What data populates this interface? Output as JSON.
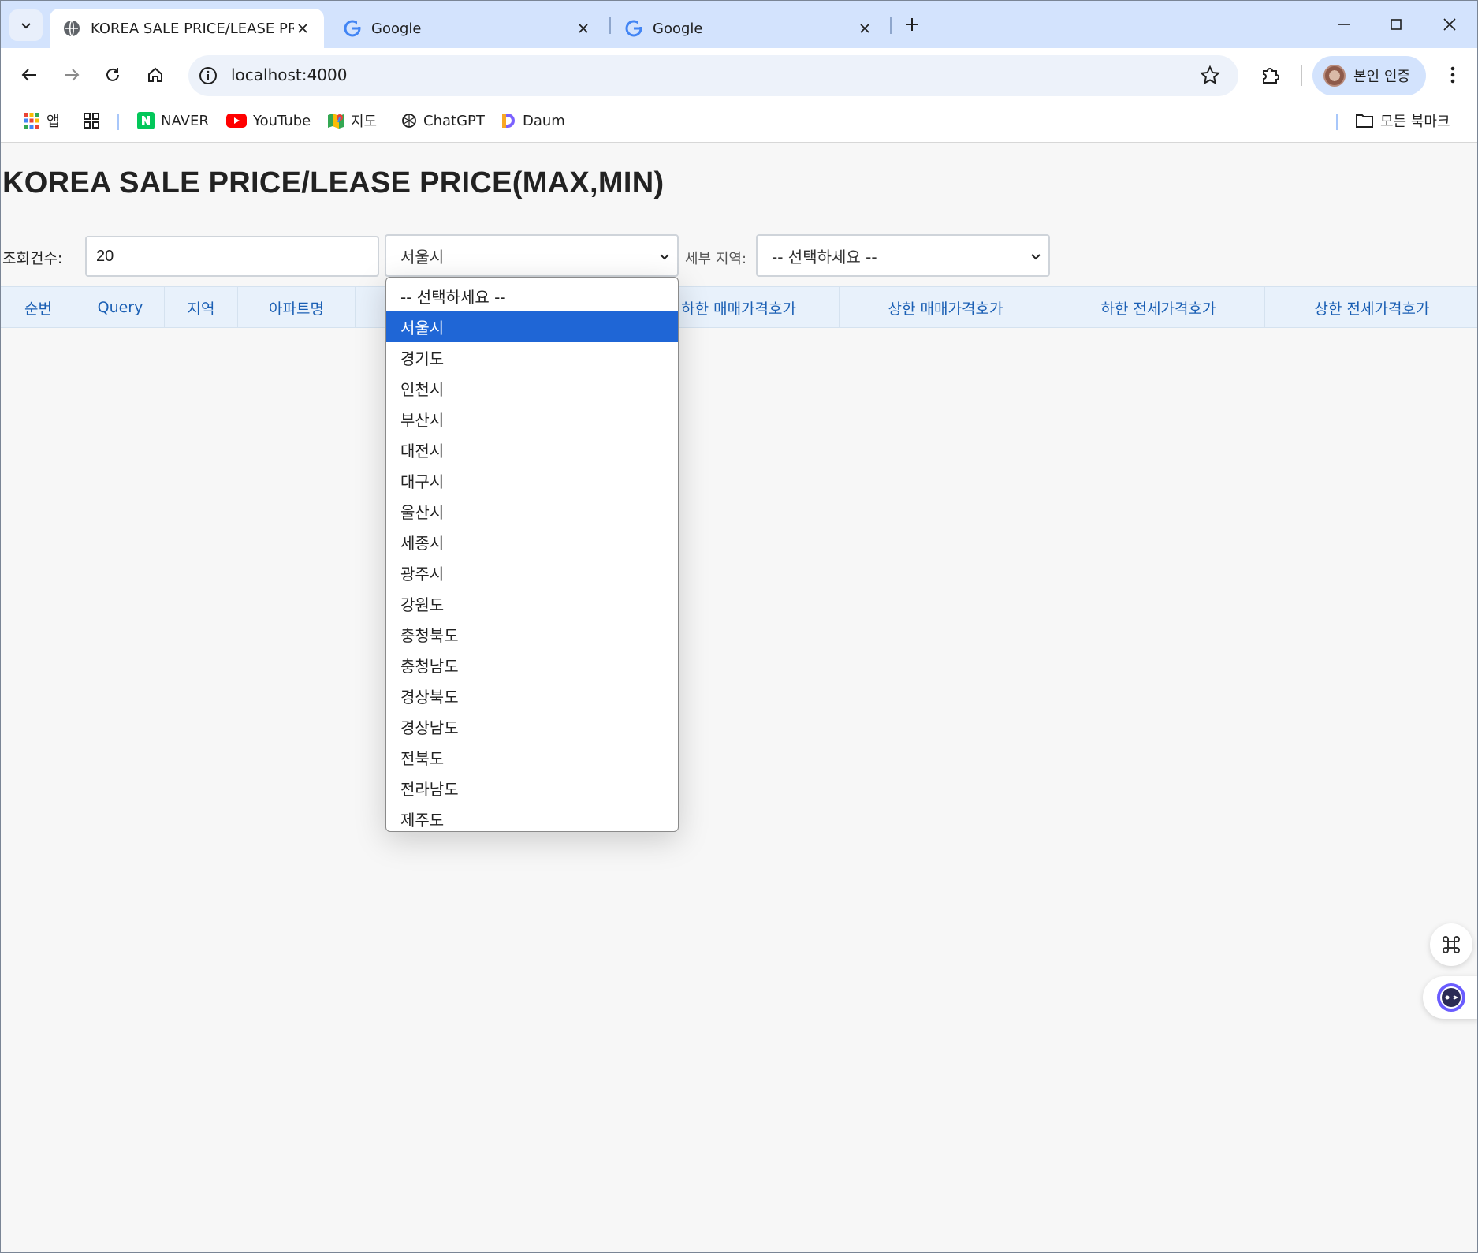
{
  "browser": {
    "tabs": [
      {
        "title": "KOREA SALE PRICE/LEASE PRIC",
        "active": true
      },
      {
        "title": "Google",
        "active": false
      },
      {
        "title": "Google",
        "active": false
      }
    ],
    "url": "localhost:4000",
    "profile_label": "본인 인증",
    "bookmarks": [
      {
        "label": "앱",
        "icon": "apps-grid-icon"
      },
      {
        "label": "",
        "icon": "tab-groups-icon"
      },
      {
        "label": "NAVER",
        "icon": "naver-icon"
      },
      {
        "label": "YouTube",
        "icon": "youtube-icon"
      },
      {
        "label": "지도",
        "icon": "maps-icon"
      },
      {
        "label": "ChatGPT",
        "icon": "chatgpt-icon"
      },
      {
        "label": "Daum",
        "icon": "daum-icon"
      }
    ],
    "all_bookmarks_label": "모든 북마크"
  },
  "page": {
    "title": "KOREA SALE PRICE/LEASE PRICE(MAX,MIN)",
    "count_label": "조회건수:",
    "count_value": "20",
    "region_selected": "서울시",
    "sub_region_label": "세부 지역:",
    "sub_region_selected": "-- 선택하세요 --"
  },
  "table": {
    "headers": [
      "순번",
      "Query",
      "지역",
      "아파트명",
      "하한 매매가격호가",
      "상한 매매가격호가",
      "하한 전세가격호가",
      "상한 전세가격호가"
    ]
  },
  "dropdown": {
    "options": [
      "-- 선택하세요 --",
      "서울시",
      "경기도",
      "인천시",
      "부산시",
      "대전시",
      "대구시",
      "울산시",
      "세종시",
      "광주시",
      "강원도",
      "충청북도",
      "충청남도",
      "경상북도",
      "경상남도",
      "전북도",
      "전라남도",
      "제주도"
    ],
    "selected_index": 1
  },
  "colors": {
    "tabstrip": "#d3e3fd",
    "header_text": "#1a5fb4",
    "header_bg": "#e8f1fb",
    "selected_option": "#1f66d6"
  }
}
